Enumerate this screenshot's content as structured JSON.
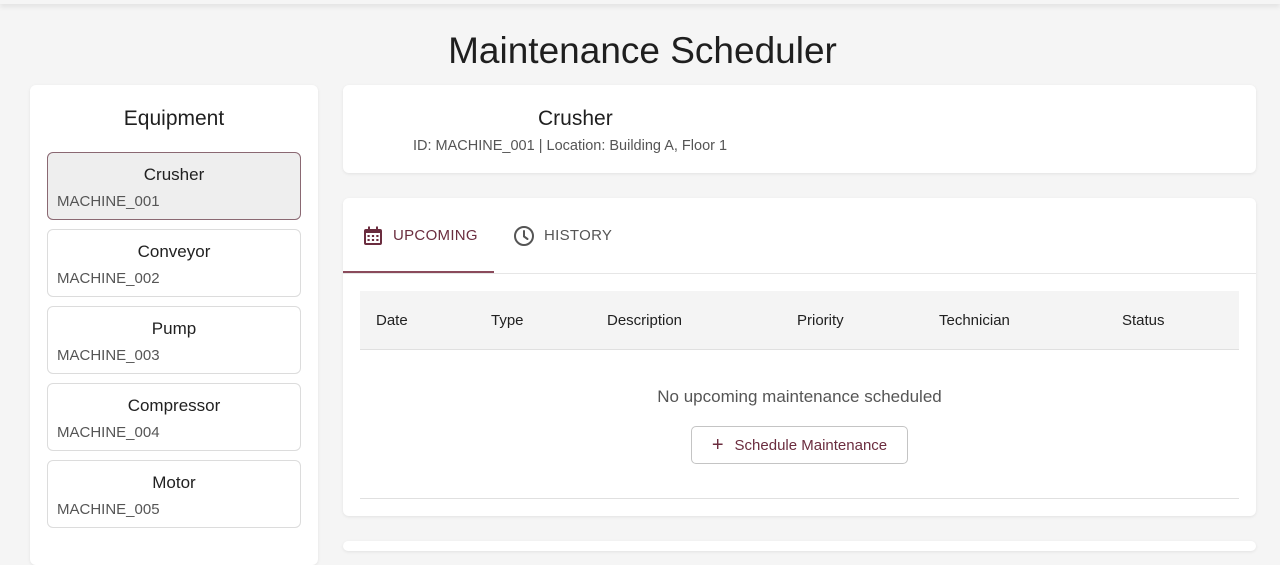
{
  "page": {
    "title": "Maintenance Scheduler"
  },
  "sidebar": {
    "title": "Equipment",
    "items": [
      {
        "name": "Crusher",
        "id": "MACHINE_001",
        "selected": true
      },
      {
        "name": "Conveyor",
        "id": "MACHINE_002",
        "selected": false
      },
      {
        "name": "Pump",
        "id": "MACHINE_003",
        "selected": false
      },
      {
        "name": "Compressor",
        "id": "MACHINE_004",
        "selected": false
      },
      {
        "name": "Motor",
        "id": "MACHINE_005",
        "selected": false
      }
    ]
  },
  "machine": {
    "name": "Crusher",
    "meta": "ID: MACHINE_001 | Location: Building A, Floor 1"
  },
  "tabs": [
    {
      "label": "UPCOMING",
      "icon": "calendar-icon",
      "active": true
    },
    {
      "label": "HISTORY",
      "icon": "clock-icon",
      "active": false
    }
  ],
  "table": {
    "columns": [
      "Date",
      "Type",
      "Description",
      "Priority",
      "Technician",
      "Status"
    ],
    "empty_message": "No upcoming maintenance scheduled",
    "schedule_button": {
      "label": "Schedule Maintenance",
      "icon": "plus-icon"
    }
  },
  "colors": {
    "accent": "#6b2d3f",
    "tab_indicator": "#8a4a5b",
    "selected_border": "#8a6872",
    "background": "#f5f5f5"
  }
}
